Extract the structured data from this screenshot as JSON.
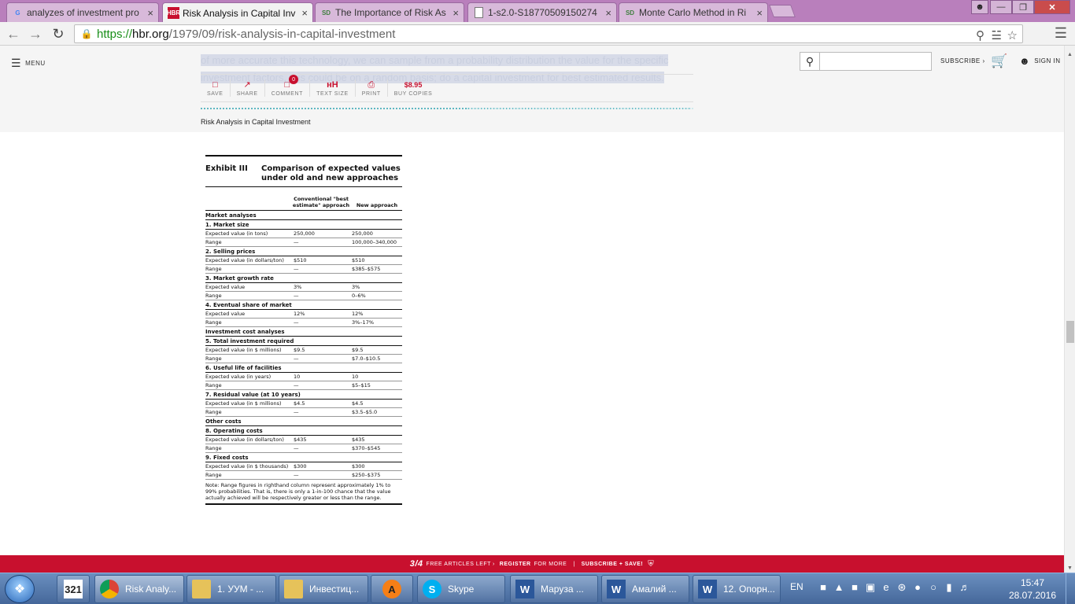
{
  "browser": {
    "tabs": [
      {
        "label": "analyzes of investment pro",
        "favicon": "G",
        "close": "×"
      },
      {
        "label": "Risk Analysis in Capital Inv",
        "favicon": "HBR",
        "close": "×"
      },
      {
        "label": "The Importance of Risk As",
        "favicon": "SD",
        "close": "×"
      },
      {
        "label": "1-s2.0-S18770509150274",
        "favicon": "doc-icon",
        "close": "×"
      },
      {
        "label": "Monte Carlo Method in Ri",
        "favicon": "SD",
        "close": "×"
      }
    ],
    "url": {
      "scheme": "https://",
      "host": "hbr.org",
      "path": "/1979/09/risk-analysis-in-capital-investment"
    }
  },
  "site": {
    "menu_label": "MENU",
    "ghost_line1": "of more accurate this technology, we can sample from a probability distribution the value for the specific",
    "ghost_line2": "investment factors, this could be on a random basis; do a capital investment for best estimated results.",
    "subscribe_label": "SUBSCRIBE",
    "signin_label": "SIGN IN",
    "tools": [
      {
        "label": "SAVE",
        "icon": "save-icon"
      },
      {
        "label": "SHARE",
        "icon": "share-icon"
      },
      {
        "label": "COMMENT",
        "icon": "comment-icon",
        "badge": "0"
      },
      {
        "label": "TEXT SIZE",
        "icon": "text-size-icon",
        "glyph": "ʜH"
      },
      {
        "label": "PRINT",
        "icon": "print-icon"
      },
      {
        "label": "BUY COPIES",
        "icon": "price",
        "price": "$8.95"
      }
    ],
    "article_title": "Risk Analysis in Capital Investment"
  },
  "exhibit": {
    "number": "Exhibit III",
    "title": "Comparison of expected values under old and new approaches",
    "col_old": "Conventional \"best estimate\" approach",
    "col_new": "New approach",
    "section_market": "Market analyses",
    "section_investment": "Investment cost analyses",
    "section_other": "Other costs",
    "groups": [
      {
        "section": "market",
        "title": "1.  Market size",
        "rows": [
          {
            "label": "Expected value (in tons)",
            "old": "250,000",
            "new": "250,000"
          },
          {
            "label": "Range",
            "old": "—",
            "new": "100,000–340,000"
          }
        ]
      },
      {
        "section": "market",
        "title": "2.  Selling prices",
        "rows": [
          {
            "label": "Expected value (in dollars/ton)",
            "old": "$510",
            "new": "$510"
          },
          {
            "label": "Range",
            "old": "—",
            "new": "$385–$575"
          }
        ]
      },
      {
        "section": "market",
        "title": "3.  Market growth rate",
        "rows": [
          {
            "label": "Expected value",
            "old": "3%",
            "new": "3%"
          },
          {
            "label": "Range",
            "old": "—",
            "new": "0–6%"
          }
        ]
      },
      {
        "section": "market",
        "title": "4.  Eventual share of market",
        "rows": [
          {
            "label": "Expected value",
            "old": "12%",
            "new": "12%"
          },
          {
            "label": "Range",
            "old": "—",
            "new": "3%–17%"
          }
        ]
      },
      {
        "section": "investment",
        "title": "5.  Total investment required",
        "rows": [
          {
            "label": "Expected value (in $ millions)",
            "old": "$9.5",
            "new": "$9.5"
          },
          {
            "label": "Range",
            "old": "—",
            "new": "$7.0–$10.5"
          }
        ]
      },
      {
        "section": "investment",
        "title": "6.  Useful life of facilities",
        "rows": [
          {
            "label": "Expected value (in years)",
            "old": "10",
            "new": "10"
          },
          {
            "label": "Range",
            "old": "—",
            "new": "$5–$15"
          }
        ]
      },
      {
        "section": "investment",
        "title": "7.  Residual value (at 10 years)",
        "rows": [
          {
            "label": "Expected value (in $ millions)",
            "old": "$4.5",
            "new": "$4.5"
          },
          {
            "label": "Range",
            "old": "—",
            "new": "$3.5–$5.0"
          }
        ]
      },
      {
        "section": "other",
        "title": "8.  Operating costs",
        "rows": [
          {
            "label": "Expected value (in dollars/ton)",
            "old": "$435",
            "new": "$435"
          },
          {
            "label": "Range",
            "old": "—",
            "new": "$370–$545"
          }
        ]
      },
      {
        "section": "other",
        "title": "9.  Fixed costs",
        "rows": [
          {
            "label": "Expected value (in $ thousands)",
            "old": "$300",
            "new": "$300"
          },
          {
            "label": "Range",
            "old": "—",
            "new": "$250–$375"
          }
        ]
      }
    ],
    "note": "Note: Range figures in righthand column represent approximately 1% to 99% probabilities. That is, there is only a 1-in-100 chance that the value actually achieved will be respectively greater or less than the range."
  },
  "paywall": {
    "count": "3/4",
    "left_text": "FREE ARTICLES LEFT",
    "register": "REGISTER",
    "for_more": "FOR MORE",
    "sep": "|",
    "subscribe_save": "SUBSCRIBE + SAVE!"
  },
  "taskbar": {
    "pinned_label": "321",
    "items": [
      {
        "label": "Risk Analy...",
        "icon": "chrome-icon"
      },
      {
        "label": "1. УУМ - ...",
        "icon": "folder-icon"
      },
      {
        "label": "Инвестиц...",
        "icon": "folder-icon"
      },
      {
        "label": "",
        "icon": "avast-icon"
      },
      {
        "label": "Skype",
        "icon": "skype-icon"
      },
      {
        "label": "Маруза ...",
        "icon": "word-icon"
      },
      {
        "label": "Амалий ...",
        "icon": "word-icon"
      },
      {
        "label": "12. Опорн...",
        "icon": "word-icon"
      }
    ],
    "lang": "EN",
    "time": "15:47",
    "date": "28.07.2016"
  },
  "colors": {
    "hbr_red": "#c8102e",
    "tab_strip": "#b97fbc",
    "taskbar": "#45679a"
  }
}
